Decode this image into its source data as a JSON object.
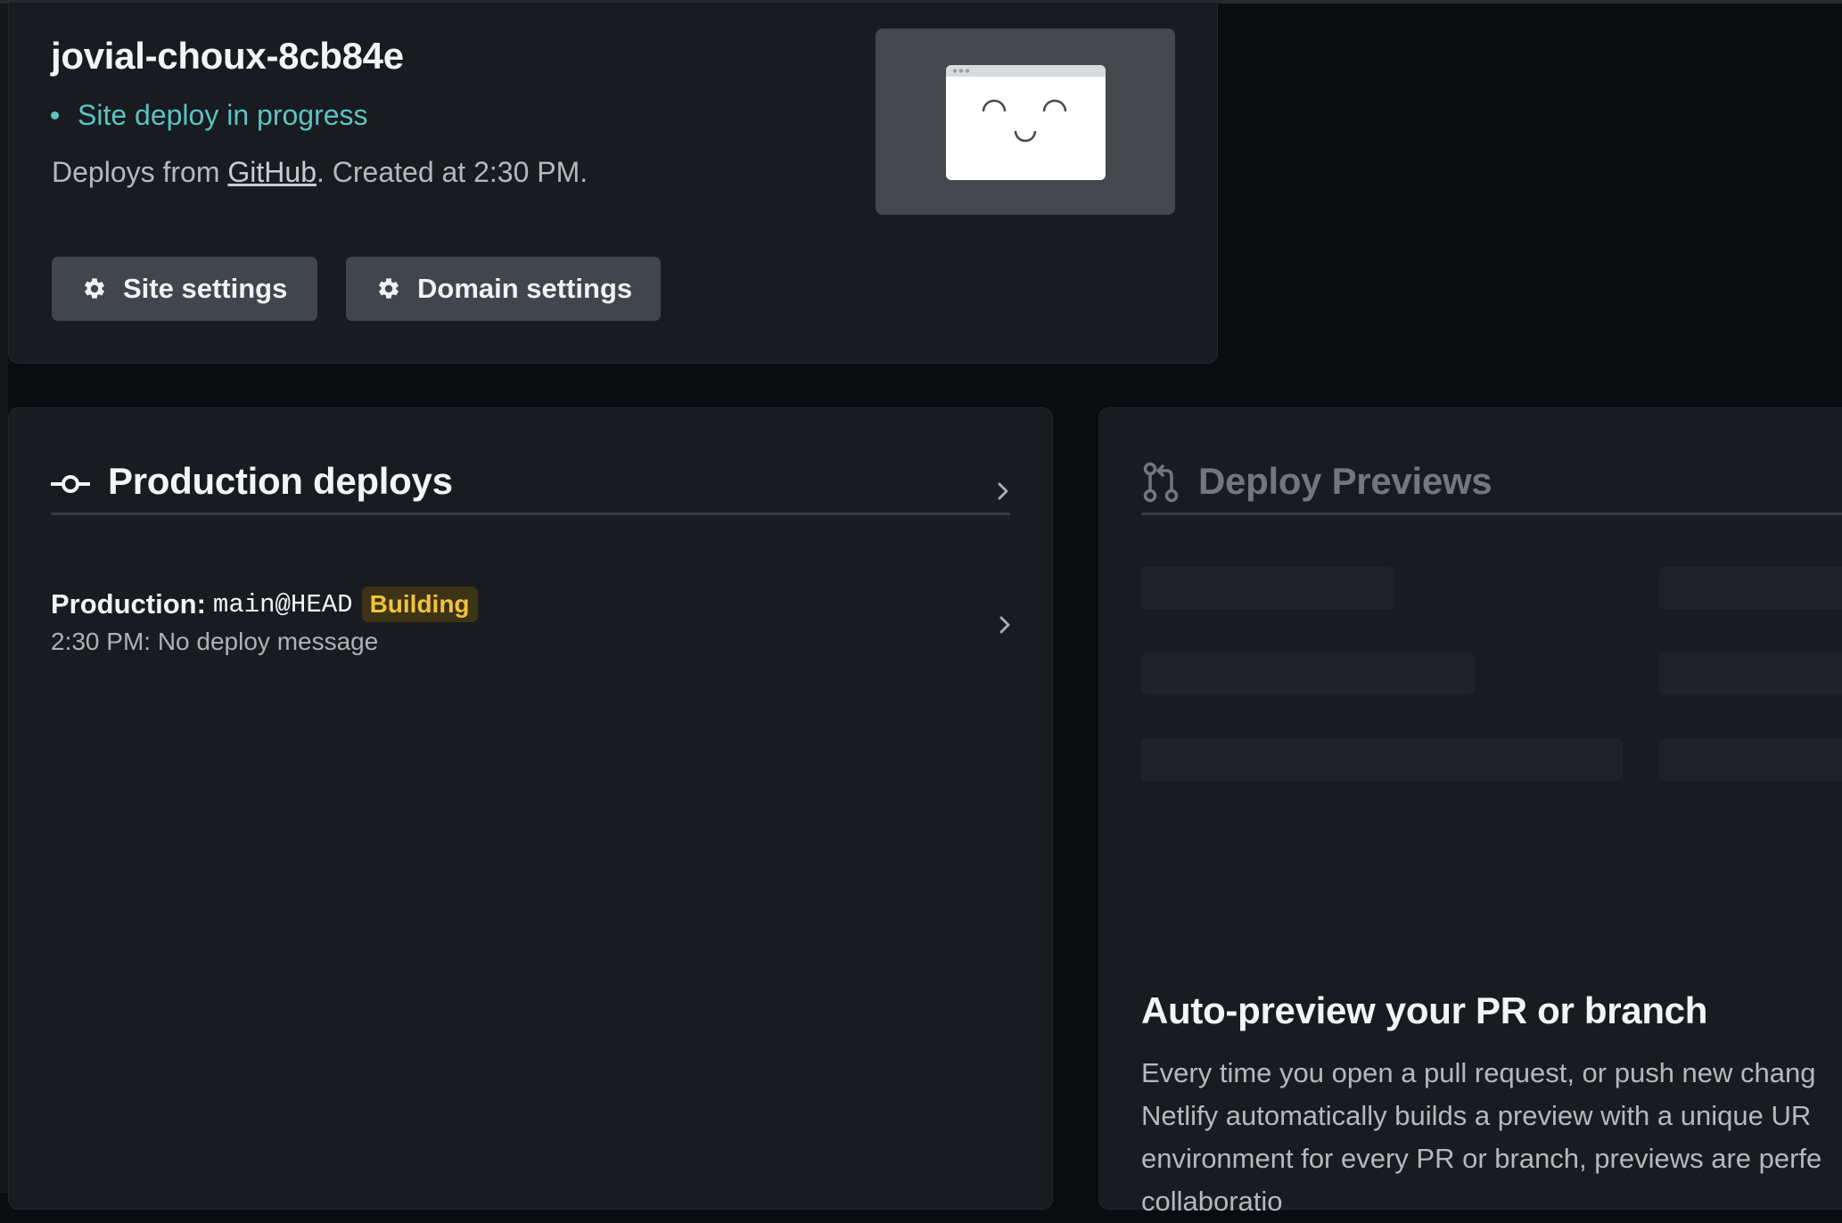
{
  "site": {
    "name": "jovial-choux-8cb84e",
    "status": "Site deploy in progress",
    "info_prefix": "Deploys from ",
    "info_link": "GitHub",
    "info_suffix": ". Created at 2:30 PM.",
    "buttons": {
      "site_settings": "Site settings",
      "domain_settings": "Domain settings"
    }
  },
  "production": {
    "title": "Production deploys",
    "deploy": {
      "prefix": "Production:",
      "branch": "main@HEAD",
      "badge": "Building",
      "message": "2:30 PM: No deploy message"
    }
  },
  "previews": {
    "title": "Deploy Previews",
    "cta_title": "Auto-preview your PR or branch",
    "cta_lines": [
      "Every time you open a pull request, or push new chang",
      "Netlify automatically builds a preview with a unique UR",
      "environment for every PR or branch, previews are perfe",
      "collaboratio"
    ]
  },
  "colors": {
    "status": "#5bc3c3",
    "badge_text": "#f3c13d",
    "badge_bg": "#3d3417"
  },
  "icons": [
    "gear-icon",
    "commit-icon",
    "pull-request-icon",
    "chevron-right-icon"
  ]
}
